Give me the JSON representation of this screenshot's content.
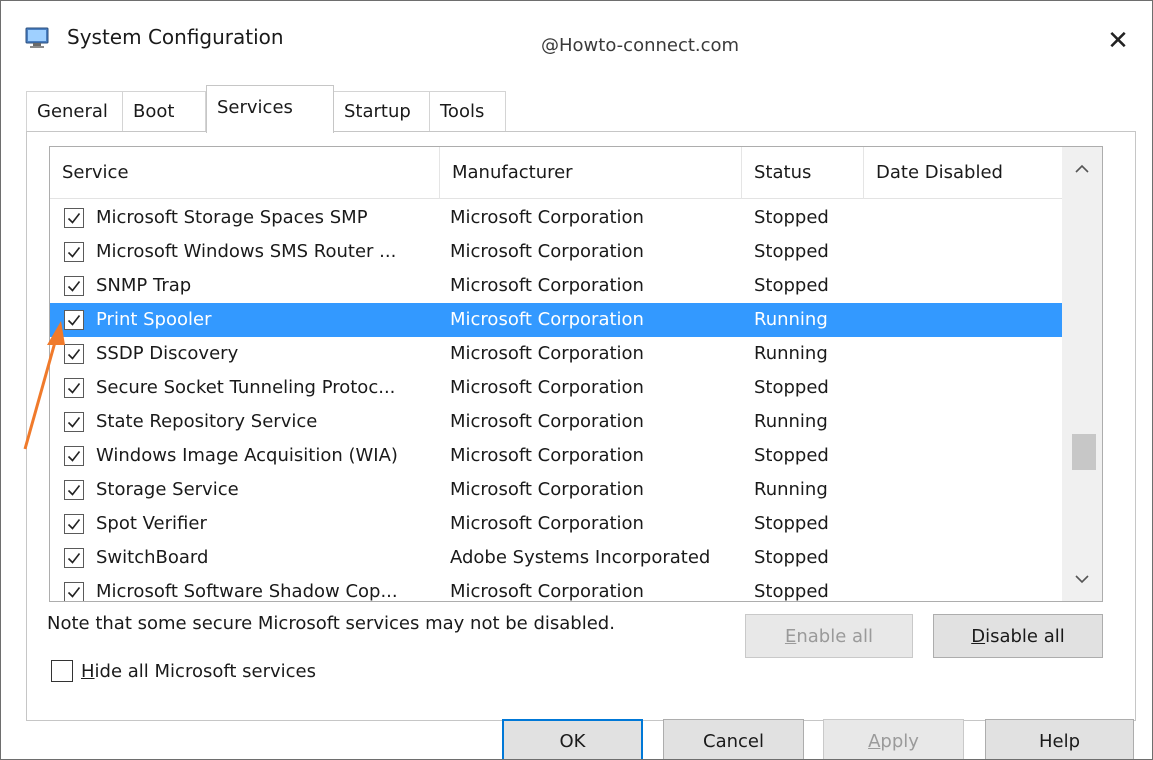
{
  "window": {
    "title": "System Configuration",
    "watermark": "@Howto-connect.com",
    "close_glyph": "✕"
  },
  "tabs": [
    {
      "label": "General",
      "active": false
    },
    {
      "label": "Boot",
      "active": false
    },
    {
      "label": "Services",
      "active": true
    },
    {
      "label": "Startup",
      "active": false
    },
    {
      "label": "Tools",
      "active": false
    }
  ],
  "services": {
    "columns": {
      "service": "Service",
      "manufacturer": "Manufacturer",
      "status": "Status",
      "date_disabled": "Date Disabled"
    },
    "rows": [
      {
        "checked": true,
        "service": "Microsoft Storage Spaces SMP",
        "manufacturer": "Microsoft Corporation",
        "status": "Stopped",
        "selected": false
      },
      {
        "checked": true,
        "service": "Microsoft Windows SMS Router ...",
        "manufacturer": "Microsoft Corporation",
        "status": "Stopped",
        "selected": false
      },
      {
        "checked": true,
        "service": "SNMP Trap",
        "manufacturer": "Microsoft Corporation",
        "status": "Stopped",
        "selected": false
      },
      {
        "checked": true,
        "service": "Print Spooler",
        "manufacturer": "Microsoft Corporation",
        "status": "Running",
        "selected": true
      },
      {
        "checked": true,
        "service": "SSDP Discovery",
        "manufacturer": "Microsoft Corporation",
        "status": "Running",
        "selected": false
      },
      {
        "checked": true,
        "service": "Secure Socket Tunneling Protoc...",
        "manufacturer": "Microsoft Corporation",
        "status": "Stopped",
        "selected": false
      },
      {
        "checked": true,
        "service": "State Repository Service",
        "manufacturer": "Microsoft Corporation",
        "status": "Running",
        "selected": false
      },
      {
        "checked": true,
        "service": "Windows Image Acquisition (WIA)",
        "manufacturer": "Microsoft Corporation",
        "status": "Stopped",
        "selected": false
      },
      {
        "checked": true,
        "service": "Storage Service",
        "manufacturer": "Microsoft Corporation",
        "status": "Running",
        "selected": false
      },
      {
        "checked": true,
        "service": "Spot Verifier",
        "manufacturer": "Microsoft Corporation",
        "status": "Stopped",
        "selected": false
      },
      {
        "checked": true,
        "service": "SwitchBoard",
        "manufacturer": "Adobe Systems Incorporated",
        "status": "Stopped",
        "selected": false
      },
      {
        "checked": true,
        "service": "Microsoft Software Shadow Cop...",
        "manufacturer": "Microsoft Corporation",
        "status": "Stopped",
        "selected": false
      }
    ],
    "scroll_up_glyph": "^",
    "scroll_down_glyph": "v",
    "note": "Note that some secure Microsoft services may not be disabled.",
    "enable_all_mnemonic": "E",
    "enable_all_rest": "nable all",
    "disable_all_mnemonic": "D",
    "disable_all_rest": "isable all",
    "hide_ms_mnemonic": "H",
    "hide_ms_rest": "ide all Microsoft services",
    "hide_ms_checked": false
  },
  "footer": {
    "ok": "OK",
    "cancel": "Cancel",
    "apply_mnemonic": "A",
    "apply_rest": "pply",
    "help": "Help"
  },
  "colors": {
    "selection": "#3399ff",
    "annotation_arrow": "#f07a2b",
    "default_button_border": "#0078d7"
  },
  "icons": [
    "system-config-icon",
    "close-icon",
    "checkbox-icon",
    "chevron-up-icon",
    "chevron-down-icon",
    "annotation-arrow"
  ]
}
